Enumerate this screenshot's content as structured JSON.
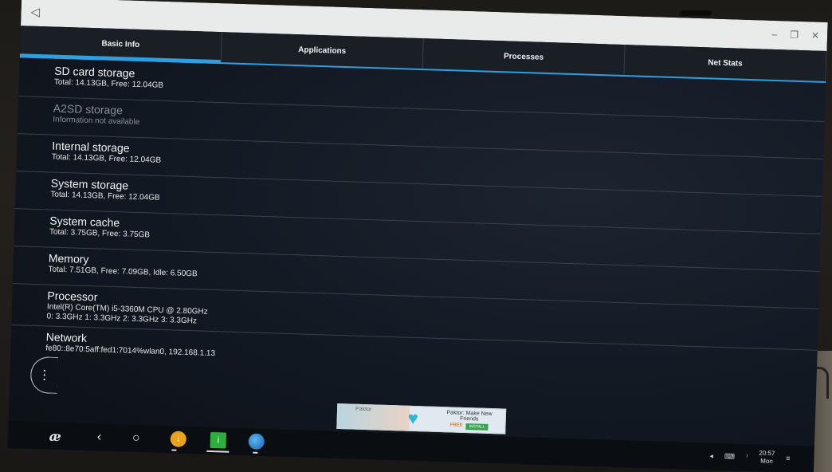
{
  "window": {
    "back_glyph": "◁",
    "minimize": "–",
    "restore": "❐",
    "close": "✕"
  },
  "tabs": [
    {
      "label": "Basic Info",
      "active": true
    },
    {
      "label": "Applications",
      "active": false
    },
    {
      "label": "Processes",
      "active": false
    },
    {
      "label": "Net Stats",
      "active": false
    }
  ],
  "rows": [
    {
      "title": "SD card storage",
      "sub": "Total: 14.13GB, Free: 12.04GB",
      "disabled": false
    },
    {
      "title": "A2SD storage",
      "sub": "Information not available",
      "disabled": true
    },
    {
      "title": "Internal storage",
      "sub": "Total: 14.13GB, Free: 12.04GB",
      "disabled": false
    },
    {
      "title": "System storage",
      "sub": "Total: 14.13GB, Free: 12.04GB",
      "disabled": false
    },
    {
      "title": "System cache",
      "sub": "Total: 3.75GB, Free: 3.75GB",
      "disabled": false
    },
    {
      "title": "Memory",
      "sub": "Total: 7.51GB, Free: 7.09GB, Idle: 6.50GB",
      "disabled": false
    },
    {
      "title": "Processor",
      "sub": "Intel(R) Core(TM) i5-3360M CPU @ 2.80GHz",
      "sub2": "0: 3.3GHz  1: 3.3GHz  2: 3.3GHz  3: 3.3GHz",
      "disabled": false
    },
    {
      "title": "Network",
      "sub": "fe80::8e70:5aff:fed1:7014%wlan0, 192.168.1.13",
      "disabled": false
    }
  ],
  "ad": {
    "logo": "Paktor",
    "line1": "Paktor: Make New",
    "line2": "Friends",
    "free": "FREE",
    "install": "INSTALL"
  },
  "taskbar": {
    "logo": "æ",
    "back": "‹",
    "home": "○",
    "app_orange": "↓",
    "app_green": "i",
    "tray_arrow": "◂",
    "keyboard": "⌨",
    "wifi": "⁾",
    "time": "20:57",
    "day": "Mon",
    "menu": "≡"
  },
  "side_handle": "⋮"
}
